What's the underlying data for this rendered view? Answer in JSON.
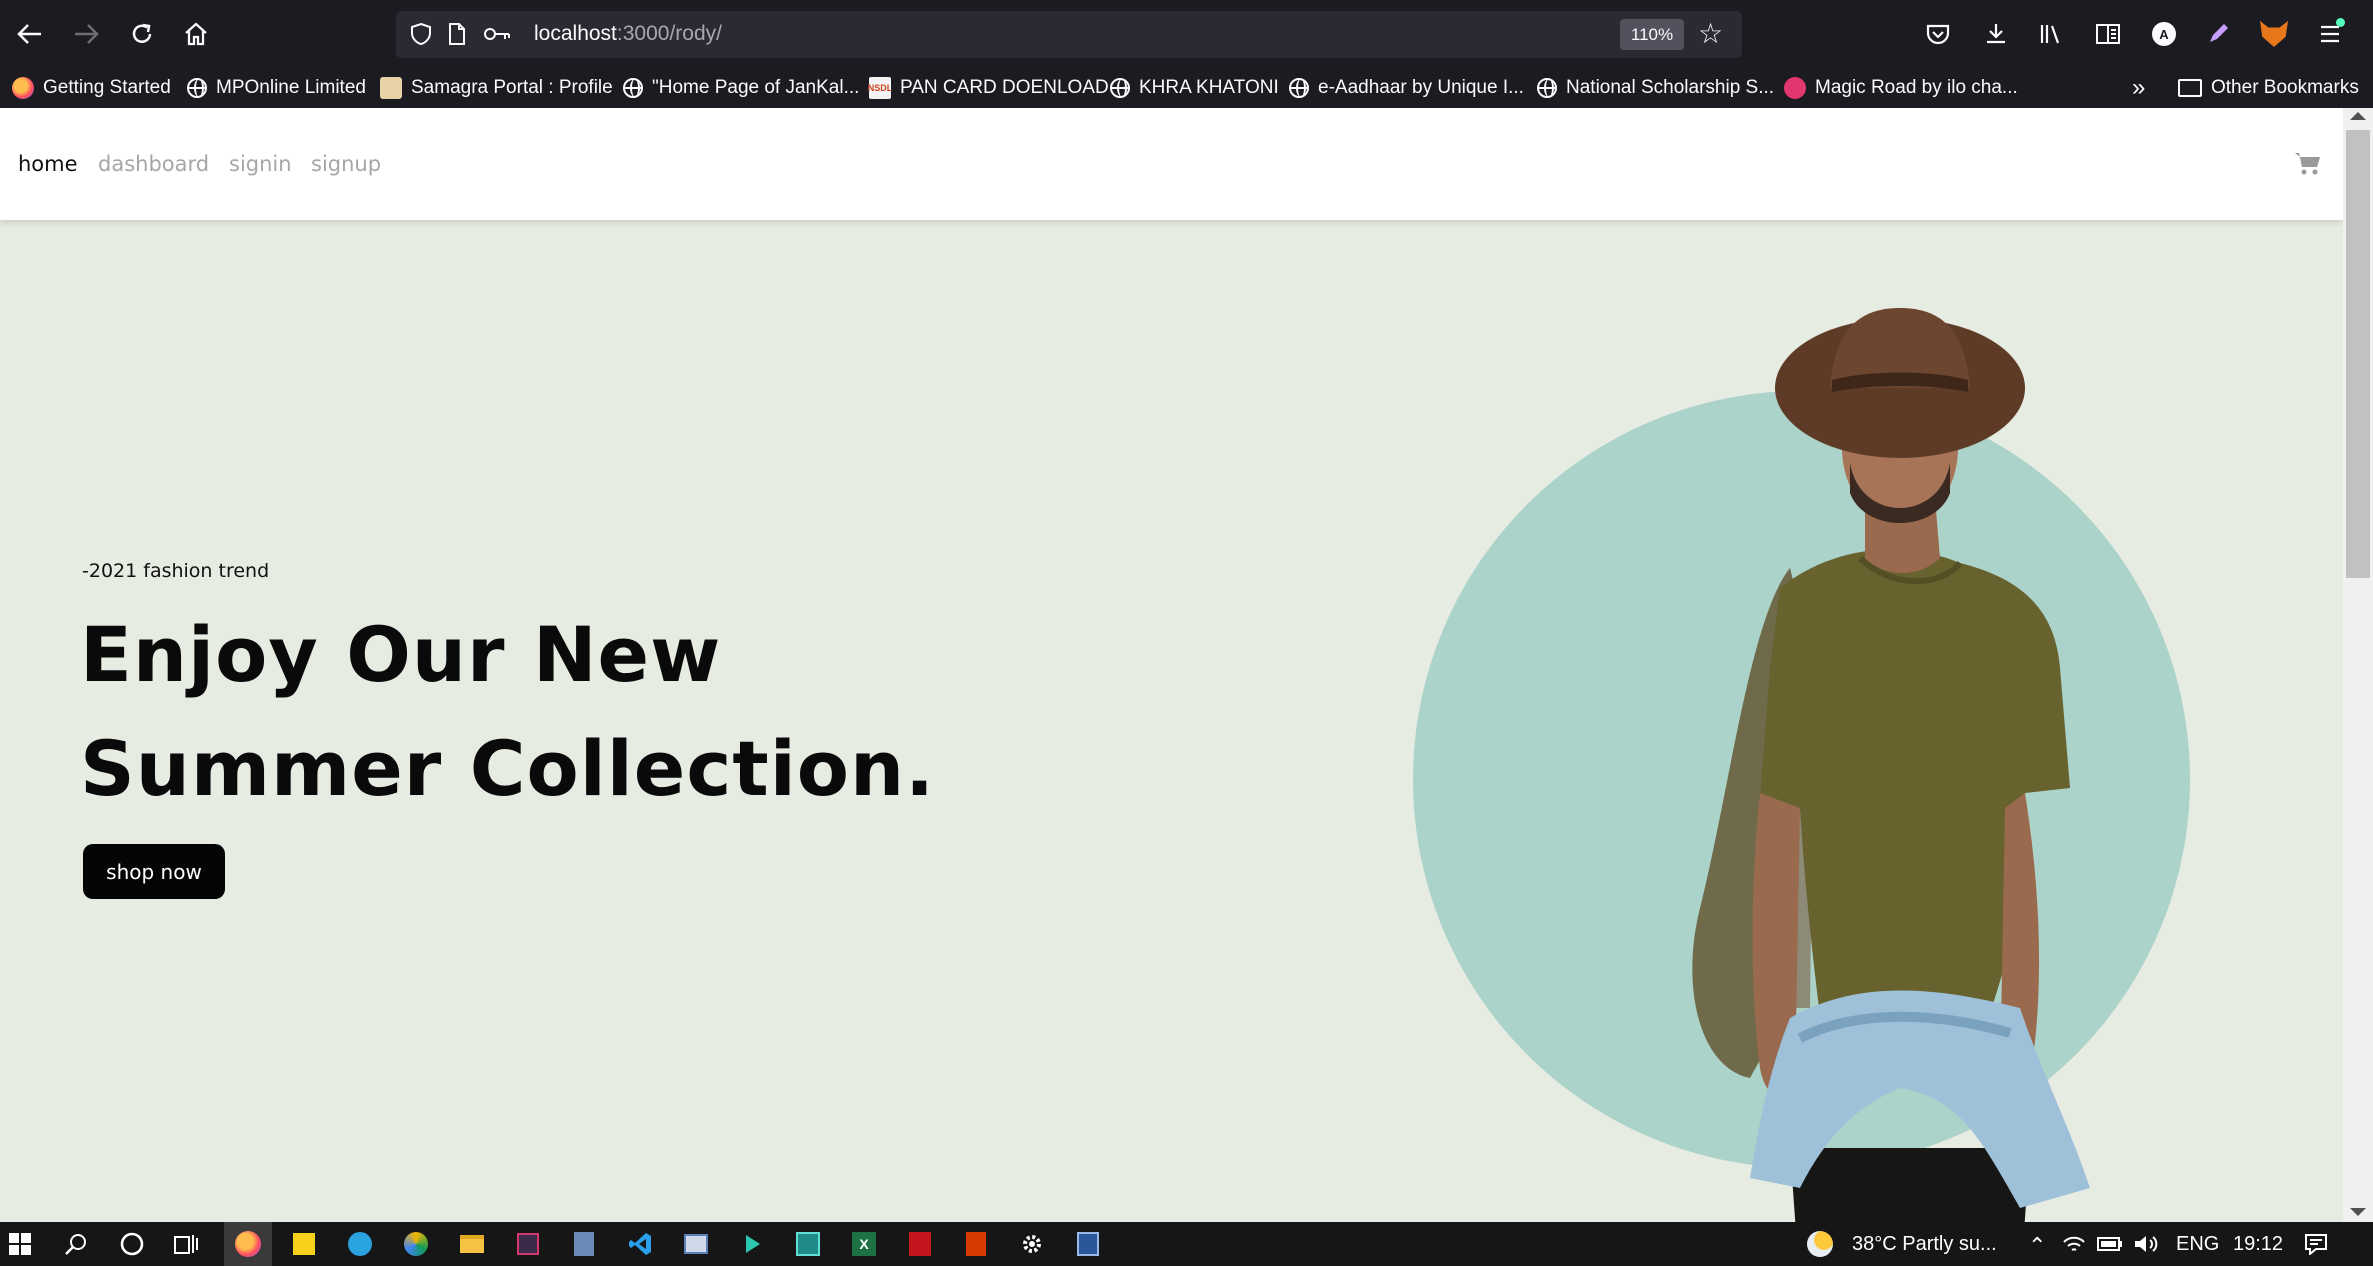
{
  "browser": {
    "url_host": "localhost",
    "url_path": ":3000/rody/",
    "zoom": "110%",
    "bookmarks": [
      {
        "label": "Getting Started",
        "icon": "firefox-icon"
      },
      {
        "label": "MPOnline Limited",
        "icon": "globe-icon"
      },
      {
        "label": "Samagra Portal : Profile",
        "icon": "site-favicon"
      },
      {
        "label": "\"Home Page of JanKal...",
        "icon": "globe-icon"
      },
      {
        "label": "PAN CARD DOENLOAD",
        "icon": "nsdl-favicon"
      },
      {
        "label": "KHRA KHATONI",
        "icon": "globe-icon"
      },
      {
        "label": "e-Aadhaar by Unique I...",
        "icon": "globe-icon"
      },
      {
        "label": "National Scholarship S...",
        "icon": "globe-icon"
      },
      {
        "label": "Magic Road by ilo cha...",
        "icon": "magic-road-favicon"
      }
    ],
    "other_bookmarks": "Other Bookmarks",
    "avatar_letter": "A"
  },
  "nav": {
    "links": [
      "home",
      "dashboard",
      "signin",
      "signup"
    ],
    "active": "home"
  },
  "hero": {
    "eyebrow": "-2021 fashion trend",
    "title_line1": "Enjoy Our New",
    "title_line2": "Summer Collection.",
    "button": "shop now",
    "circle_color": "#acd3ca",
    "background_color": "#e6ece2"
  },
  "taskbar": {
    "weather": "38°C  Partly su...",
    "language": "ENG",
    "time": "19:12"
  }
}
